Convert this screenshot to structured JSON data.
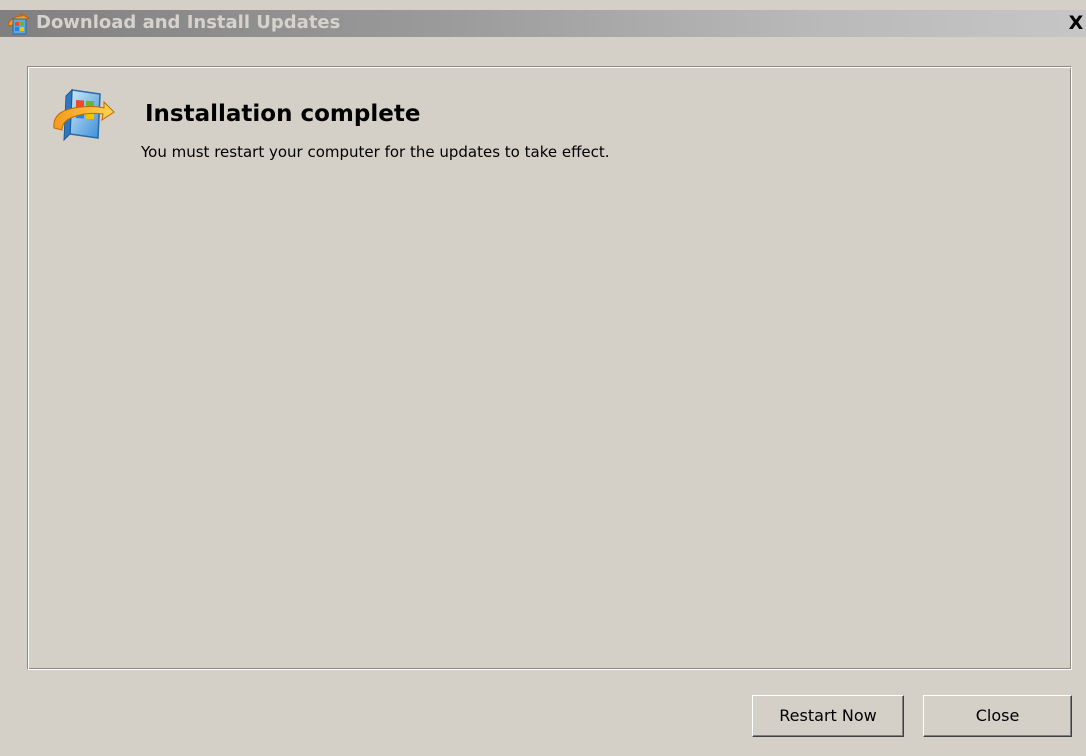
{
  "window": {
    "title": "Download and Install Updates",
    "close_glyph": "X",
    "icon": "windows-update-icon"
  },
  "status": {
    "icon": "windows-update-icon",
    "heading": "Installation complete",
    "message": "You must restart your computer for the updates to take effect."
  },
  "buttons": {
    "restart_label": "Restart Now",
    "close_label": "Close"
  },
  "colors": {
    "window_background": "#d4d0c8",
    "titlebar_start": "#808080",
    "titlebar_end": "#c6c6c6",
    "title_text": "#d6d3ce"
  }
}
